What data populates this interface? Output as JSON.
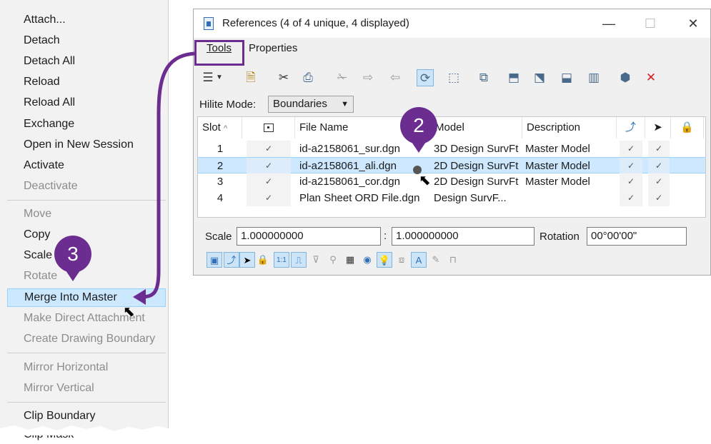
{
  "context_menu": {
    "items": [
      {
        "label": "Attach...",
        "state": "enabled"
      },
      {
        "label": "Detach",
        "state": "enabled"
      },
      {
        "label": "Detach All",
        "state": "enabled"
      },
      {
        "label": "Reload",
        "state": "enabled"
      },
      {
        "label": "Reload All",
        "state": "enabled"
      },
      {
        "label": "Exchange",
        "state": "enabled"
      },
      {
        "label": "Open in New Session",
        "state": "enabled"
      },
      {
        "label": "Activate",
        "state": "enabled"
      },
      {
        "label": "Deactivate",
        "state": "disabled"
      },
      {
        "label": "Move",
        "state": "disabled"
      },
      {
        "label": "Copy",
        "state": "enabled"
      },
      {
        "label": "Scale",
        "state": "enabled"
      },
      {
        "label": "Rotate",
        "state": "disabled"
      },
      {
        "label": "Merge Into Master",
        "state": "selected"
      },
      {
        "label": "Make Direct Attachment",
        "state": "disabled"
      },
      {
        "label": "Create Drawing Boundary",
        "state": "disabled"
      },
      {
        "label": "Mirror Horizontal",
        "state": "disabled"
      },
      {
        "label": "Mirror Vertical",
        "state": "disabled"
      },
      {
        "label": "Clip Boundary",
        "state": "enabled"
      },
      {
        "label": "Clip Mask",
        "state": "enabled"
      }
    ]
  },
  "dialog": {
    "title": "References (4 of 4 unique, 4 displayed)",
    "minimize": "—",
    "maximize": "☐",
    "close": "✕",
    "menu": {
      "tools": "Tools",
      "properties": "Properties"
    },
    "hilite": {
      "label": "Hilite Mode:",
      "value": "Boundaries"
    },
    "table": {
      "headers": {
        "slot": "Slot",
        "file_name": "File Name",
        "model": "Model",
        "description": "Description"
      },
      "rows": [
        {
          "slot": "1",
          "file": "id-a2158061_sur.dgn",
          "model": "3D Design SurvFt",
          "description": "Master Model",
          "checks": [
            "✓",
            "✓",
            "✓"
          ]
        },
        {
          "slot": "2",
          "file": "id-a2158061_ali.dgn",
          "model": "2D Design SurvFt",
          "description": "Master Model",
          "checks": [
            "✓",
            "✓",
            "✓"
          ]
        },
        {
          "slot": "3",
          "file": "id-a2158061_cor.dgn",
          "model": "2D Design SurvFt",
          "description": "Master Model",
          "checks": [
            "✓",
            "✓",
            "✓"
          ]
        },
        {
          "slot": "4",
          "file": "Plan Sheet ORD File.dgn",
          "model": "Design SurvF...",
          "description": "",
          "checks": [
            "✓",
            "✓",
            "✓"
          ]
        }
      ],
      "selected_row": 2
    },
    "scale": {
      "label": "Scale",
      "x": "1.000000000",
      "separator": ":",
      "y": "1.000000000"
    },
    "rotation": {
      "label": "Rotation",
      "value": "00°00'00\""
    }
  },
  "callouts": {
    "two": "2",
    "three": "3"
  },
  "colors": {
    "accent": "#6b2d8f",
    "selection": "#cce8ff"
  }
}
